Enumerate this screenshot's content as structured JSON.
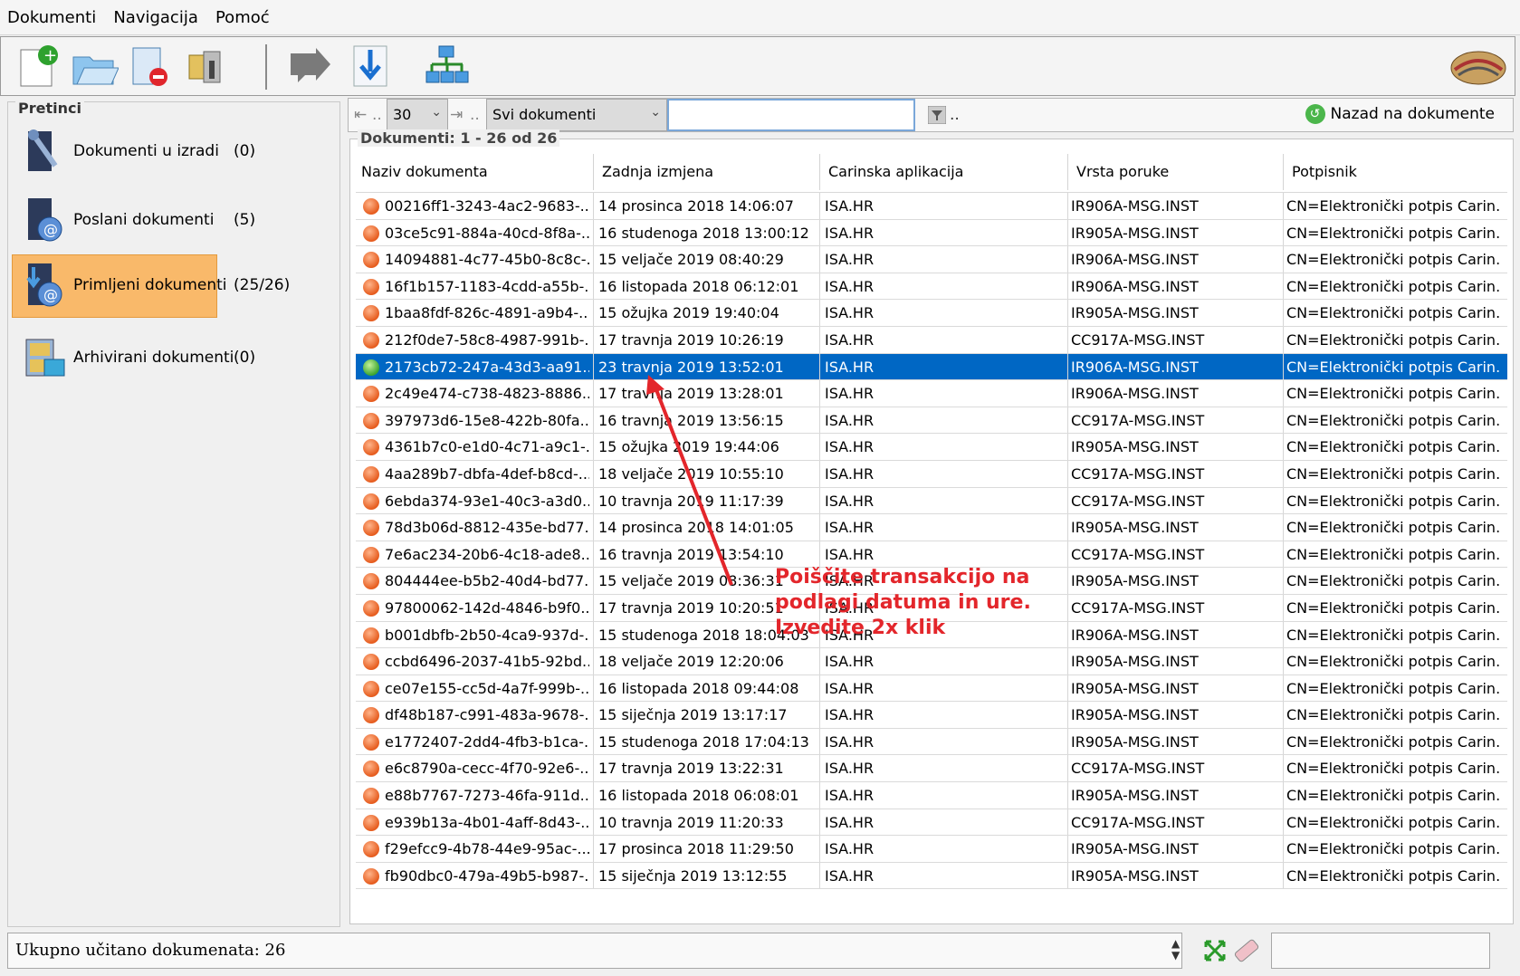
{
  "menu": [
    "Dokumenti",
    "Navigacija",
    "Pomoć"
  ],
  "toolbar_icons": [
    "new-document-icon",
    "open-folder-icon",
    "delete-document-icon",
    "archive-icon",
    "forward-icon",
    "download-icon",
    "network-icon"
  ],
  "sidebar": {
    "title": "Pretinci",
    "folders": [
      {
        "label": "Dokumenti u izradi",
        "count": "(0)",
        "icon": "tools-icon"
      },
      {
        "label": "Poslani dokumenti",
        "count": "(5)",
        "icon": "sent-mail-icon"
      },
      {
        "label": "Primljeni dokumenti",
        "count": "(25/26)",
        "icon": "received-mail-icon"
      },
      {
        "label": "Arhivirani dokumenti",
        "count": "(0)",
        "icon": "archive-cabinet-icon"
      }
    ]
  },
  "navbar": {
    "page_size": "30",
    "filter": "Svi dokumenti",
    "search_value": "",
    "more": "..",
    "back_label": "Nazad na dokumente"
  },
  "documents": {
    "title": "Dokumenti: 1 - 26 od 26",
    "columns": [
      "Naziv dokumenta",
      "Zadnja izmjena",
      "Carinska aplikacija",
      "Vrsta poruke",
      "Potpisnik"
    ],
    "rows": [
      {
        "name": "00216ff1-3243-4ac2-9683-...",
        "date": "14 prosinca 2018 14:06:07",
        "app": "ISA.HR",
        "type": "IR906A-MSG.INST",
        "signer": "CN=Elektronički potpis Carin..."
      },
      {
        "name": "03ce5c91-884a-40cd-8f8a-...",
        "date": "16 studenoga 2018 13:00:12",
        "app": "ISA.HR",
        "type": "IR905A-MSG.INST",
        "signer": "CN=Elektronički potpis Carin..."
      },
      {
        "name": "14094881-4c77-45b0-8c8c-...",
        "date": "15 veljače 2019 08:40:29",
        "app": "ISA.HR",
        "type": "IR906A-MSG.INST",
        "signer": "CN=Elektronički potpis Carin..."
      },
      {
        "name": "16f1b157-1183-4cdd-a55b-...",
        "date": "16 listopada 2018 06:12:01",
        "app": "ISA.HR",
        "type": "IR906A-MSG.INST",
        "signer": "CN=Elektronički potpis Carin..."
      },
      {
        "name": "1baa8fdf-826c-4891-a9b4-...",
        "date": "15 ožujka 2019 19:40:04",
        "app": "ISA.HR",
        "type": "IR905A-MSG.INST",
        "signer": "CN=Elektronički potpis Carin..."
      },
      {
        "name": "212f0de7-58c8-4987-991b-...",
        "date": "17 travnja 2019 10:26:19",
        "app": "ISA.HR",
        "type": "CC917A-MSG.INST",
        "signer": "CN=Elektronički potpis Carin..."
      },
      {
        "name": "2173cb72-247a-43d3-aa91...",
        "date": "23 travnja 2019 13:52:01",
        "app": "ISA.HR",
        "type": "IR906A-MSG.INST",
        "signer": "CN=Elektronički potpis Carin...",
        "selected": true
      },
      {
        "name": "2c49e474-c738-4823-8886...",
        "date": "17 travnja 2019 13:28:01",
        "app": "ISA.HR",
        "type": "IR906A-MSG.INST",
        "signer": "CN=Elektronički potpis Carin..."
      },
      {
        "name": "397973d6-15e8-422b-80fa...",
        "date": "16 travnja 2019 13:56:15",
        "app": "ISA.HR",
        "type": "CC917A-MSG.INST",
        "signer": "CN=Elektronički potpis Carin..."
      },
      {
        "name": "4361b7c0-e1d0-4c71-a9c1-...",
        "date": "15 ožujka 2019 19:44:06",
        "app": "ISA.HR",
        "type": "IR905A-MSG.INST",
        "signer": "CN=Elektronički potpis Carin..."
      },
      {
        "name": "4aa289b7-dbfa-4def-b8cd-...",
        "date": "18 veljače 2019 10:55:10",
        "app": "ISA.HR",
        "type": "CC917A-MSG.INST",
        "signer": "CN=Elektronički potpis Carin..."
      },
      {
        "name": "6ebda374-93e1-40c3-a3d0...",
        "date": "10 travnja 2019 11:17:39",
        "app": "ISA.HR",
        "type": "CC917A-MSG.INST",
        "signer": "CN=Elektronički potpis Carin..."
      },
      {
        "name": "78d3b06d-8812-435e-bd77...",
        "date": "14 prosinca 2018 14:01:05",
        "app": "ISA.HR",
        "type": "IR905A-MSG.INST",
        "signer": "CN=Elektronički potpis Carin..."
      },
      {
        "name": "7e6ac234-20b6-4c18-ade8...",
        "date": "16 travnja 2019 13:54:10",
        "app": "ISA.HR",
        "type": "CC917A-MSG.INST",
        "signer": "CN=Elektronički potpis Carin..."
      },
      {
        "name": "804444ee-b5b2-40d4-bd77...",
        "date": "15 veljače 2019 08:36:31",
        "app": "ISA.HR",
        "type": "IR905A-MSG.INST",
        "signer": "CN=Elektronički potpis Carin..."
      },
      {
        "name": "97800062-142d-4846-b9f0...",
        "date": "17 travnja 2019 10:20:51",
        "app": "ISA.HR",
        "type": "CC917A-MSG.INST",
        "signer": "CN=Elektronički potpis Carin..."
      },
      {
        "name": "b001dbfb-2b50-4ca9-937d-...",
        "date": "15 studenoga 2018 18:04:03",
        "app": "ISA.HR",
        "type": "IR906A-MSG.INST",
        "signer": "CN=Elektronički potpis Carin..."
      },
      {
        "name": "ccbd6496-2037-41b5-92bd...",
        "date": "18 veljače 2019 12:20:06",
        "app": "ISA.HR",
        "type": "IR905A-MSG.INST",
        "signer": "CN=Elektronički potpis Carin..."
      },
      {
        "name": "ce07e155-cc5d-4a7f-999b-...",
        "date": "16 listopada 2018 09:44:08",
        "app": "ISA.HR",
        "type": "IR905A-MSG.INST",
        "signer": "CN=Elektronički potpis Carin..."
      },
      {
        "name": "df48b187-c991-483a-9678-...",
        "date": "15 siječnja 2019 13:17:17",
        "app": "ISA.HR",
        "type": "IR905A-MSG.INST",
        "signer": "CN=Elektronički potpis Carin..."
      },
      {
        "name": "e1772407-2dd4-4fb3-b1ca-...",
        "date": "15 studenoga 2018 17:04:13",
        "app": "ISA.HR",
        "type": "IR905A-MSG.INST",
        "signer": "CN=Elektronički potpis Carin..."
      },
      {
        "name": "e6c8790a-cecc-4f70-92e6-...",
        "date": "17 travnja 2019 13:22:31",
        "app": "ISA.HR",
        "type": "CC917A-MSG.INST",
        "signer": "CN=Elektronički potpis Carin..."
      },
      {
        "name": "e88b7767-7273-46fa-911d...",
        "date": "16 listopada 2018 06:08:01",
        "app": "ISA.HR",
        "type": "IR905A-MSG.INST",
        "signer": "CN=Elektronički potpis Carin..."
      },
      {
        "name": "e939b13a-4b01-4aff-8d43-...",
        "date": "10 travnja 2019 11:20:33",
        "app": "ISA.HR",
        "type": "CC917A-MSG.INST",
        "signer": "CN=Elektronički potpis Carin..."
      },
      {
        "name": "f29efcc9-4b78-44e9-95ac-...",
        "date": "17 prosinca 2018 11:29:50",
        "app": "ISA.HR",
        "type": "IR905A-MSG.INST",
        "signer": "CN=Elektronički potpis Carin..."
      },
      {
        "name": "fb90dbc0-479a-49b5-b987-...",
        "date": "15 siječnja 2019 13:12:55",
        "app": "ISA.HR",
        "type": "IR905A-MSG.INST",
        "signer": "CN=Elektronički potpis Carin..."
      }
    ]
  },
  "annotation": "Poiščite transakcijo na\npodlagi datuma in ure.\nIzvedite 2x klik",
  "status": {
    "text": "Ukupno učitano dokumenata: 26"
  },
  "colors": {
    "selection": "#0067c4",
    "folder_selected": "#f9b96a",
    "annotation": "#e3262b"
  }
}
